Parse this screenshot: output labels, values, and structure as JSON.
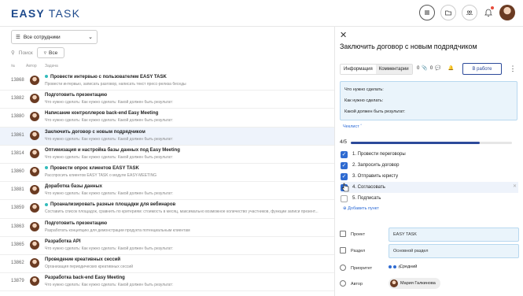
{
  "app": {
    "logo_bold": "EASY",
    "logo_light": " TASK"
  },
  "toolbar": {
    "employees_select": "Все сотрудники",
    "search_placeholder": "Поиск",
    "filter_label": "Все"
  },
  "columns": {
    "num": "№",
    "author": "Автор",
    "task": "Задача"
  },
  "tasks": [
    {
      "id": "13868",
      "title": "Провести интервью с пользователем EASY TASK",
      "desc": "Провести интервью, записать разговор, написать текст пресс-релиза беседы",
      "dot": true
    },
    {
      "id": "13882",
      "title": "Подготовить презентацию",
      "desc": "Что нужно сделать: Как нужно сделать: Какой должен быть результат:",
      "dot": false
    },
    {
      "id": "13880",
      "title": "Написание контроллеров back-end Easy Meeting",
      "desc": "Что нужно сделать: Как нужно сделать: Какой должен быть результат:",
      "dot": false
    },
    {
      "id": "13861",
      "title": "Заключить договор с новым подрядчиком",
      "desc": "Что нужно сделать: Как нужно сделать: Какой должен быть результат:",
      "dot": false
    },
    {
      "id": "13814",
      "title": "Оптимизация и настройка базы данных под Easy Meeting",
      "desc": "Что нужно сделать: Как нужно сделать: Какой должен быть результат:",
      "dot": false
    },
    {
      "id": "13860",
      "title": "Провести опрос клиентов EASY TASK",
      "desc": "Расспросить клиентов EASY TASK о модуле EASY-MEETING",
      "dot": true
    },
    {
      "id": "13881",
      "title": "Доработка базы данных",
      "desc": "Что нужно сделать: Как нужно сделать: Какой должен быть результат:",
      "dot": false
    },
    {
      "id": "13859",
      "title": "Проанализировать разные площадки для вебинаров",
      "desc": "Составить список площадок, сравнить по критериям: стоимость в месяц, максимально возможное количество участников, функции записи презент...",
      "dot": true
    },
    {
      "id": "13863",
      "title": "Подготовить презентацию",
      "desc": "Разработать концепцию для демонстрации продукта потенциальным клиентам",
      "dot": false
    },
    {
      "id": "13865",
      "title": "Разработка API",
      "desc": "Что нужно сделать: Как нужно сделать: Какой должен быть результат:",
      "dot": false
    },
    {
      "id": "13862",
      "title": "Проведение креативных сессий",
      "desc": "Организация периодических креативных сессий",
      "dot": false
    },
    {
      "id": "13879",
      "title": "Разработка back-end Easy Meeting",
      "desc": "Что нужно сделать: Как нужно сделать: Какой должен быть результат:",
      "dot": false
    }
  ],
  "panel": {
    "title": "Заключить договор с новым подрядчиком",
    "tab_info": "Информация",
    "tab_comments": "Комментарии",
    "attach_count": "0",
    "comment_count": "0",
    "status": "В работе",
    "desc_lines": [
      "Что нужно сделать:",
      "Как нужно сделать:",
      "Какой должен быть результат:"
    ],
    "checklist_header": "Чеклист",
    "progress_label": "4/5",
    "progress_fraction": 0.8,
    "checklist": [
      {
        "text": "1. Провести переговоры",
        "checked": true
      },
      {
        "text": "2. Запросить договор",
        "checked": true
      },
      {
        "text": "3. Отправить юристу",
        "checked": true
      },
      {
        "text": "4. Согласовать",
        "checked": true
      },
      {
        "text": "5. Подписать",
        "checked": false
      }
    ],
    "add_item": "Добавить пункт",
    "fields": {
      "project_label": "Проект",
      "project_value": "EASY TASK",
      "section_label": "Раздел",
      "section_value": "Основной раздел",
      "priority_label": "Приоритет",
      "priority_value": "Средний",
      "author_label": "Автор",
      "author_value": "Мария Галкинова"
    }
  },
  "colors": {
    "accent": "#2c4a9a",
    "check": "#2f6bd1",
    "link": "#2c6bd6"
  }
}
